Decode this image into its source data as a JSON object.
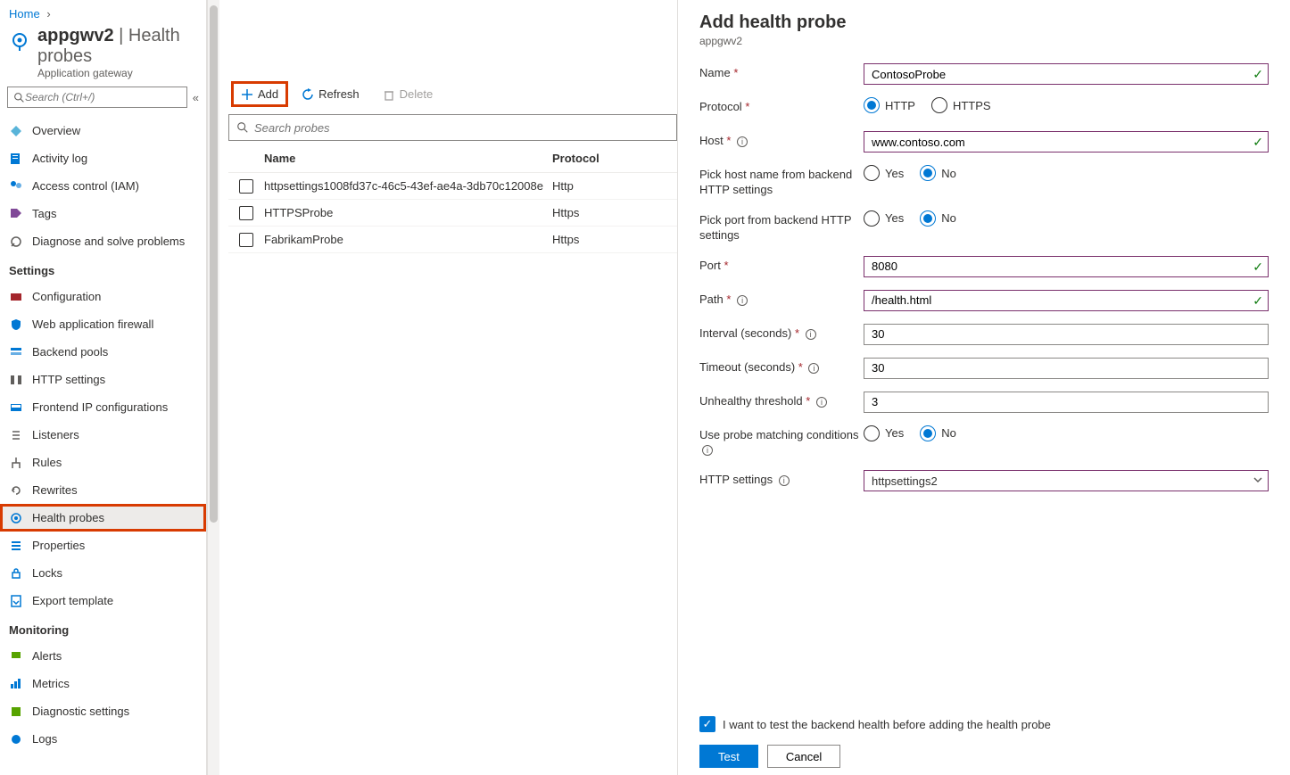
{
  "breadcrumb": {
    "home": "Home"
  },
  "header": {
    "resource_name": "appgwv2",
    "section": "Health probes",
    "subtitle": "Application gateway",
    "search_placeholder": "Search (Ctrl+/)"
  },
  "nav": {
    "overview": "Overview",
    "activity_log": "Activity log",
    "iam": "Access control (IAM)",
    "tags": "Tags",
    "diagnose": "Diagnose and solve problems",
    "section_settings": "Settings",
    "configuration": "Configuration",
    "waf": "Web application firewall",
    "backend_pools": "Backend pools",
    "http_settings": "HTTP settings",
    "frontend_ip": "Frontend IP configurations",
    "listeners": "Listeners",
    "rules": "Rules",
    "rewrites": "Rewrites",
    "health_probes": "Health probes",
    "properties": "Properties",
    "locks": "Locks",
    "export_template": "Export template",
    "section_monitoring": "Monitoring",
    "alerts": "Alerts",
    "metrics": "Metrics",
    "diag_settings": "Diagnostic settings",
    "logs": "Logs"
  },
  "toolbar": {
    "add": "Add",
    "refresh": "Refresh",
    "delete": "Delete",
    "search_placeholder": "Search probes"
  },
  "table": {
    "col_name": "Name",
    "col_protocol": "Protocol",
    "rows": [
      {
        "name": "httpsettings1008fd37c-46c5-43ef-ae4a-3db70c12008e",
        "protocol": "Http"
      },
      {
        "name": "HTTPSProbe",
        "protocol": "Https"
      },
      {
        "name": "FabrikamProbe",
        "protocol": "Https"
      }
    ]
  },
  "panel": {
    "title": "Add health probe",
    "subtitle": "appgwv2",
    "labels": {
      "name": "Name",
      "protocol": "Protocol",
      "host": "Host",
      "pick_host": "Pick host name from backend HTTP settings",
      "pick_port": "Pick port from backend HTTP settings",
      "port": "Port",
      "path": "Path",
      "interval": "Interval (seconds)",
      "timeout": "Timeout (seconds)",
      "unhealthy": "Unhealthy threshold",
      "matching": "Use probe matching conditions",
      "http_settings": "HTTP settings"
    },
    "values": {
      "name": "ContosoProbe",
      "protocol_http": "HTTP",
      "protocol_https": "HTTPS",
      "host": "www.contoso.com",
      "yes": "Yes",
      "no": "No",
      "port": "8080",
      "path": "/health.html",
      "interval": "30",
      "timeout": "30",
      "unhealthy": "3",
      "http_settings": "httpsettings2"
    },
    "footer": {
      "checkbox_label": "I want to test the backend health before adding the health probe",
      "test": "Test",
      "cancel": "Cancel"
    }
  }
}
